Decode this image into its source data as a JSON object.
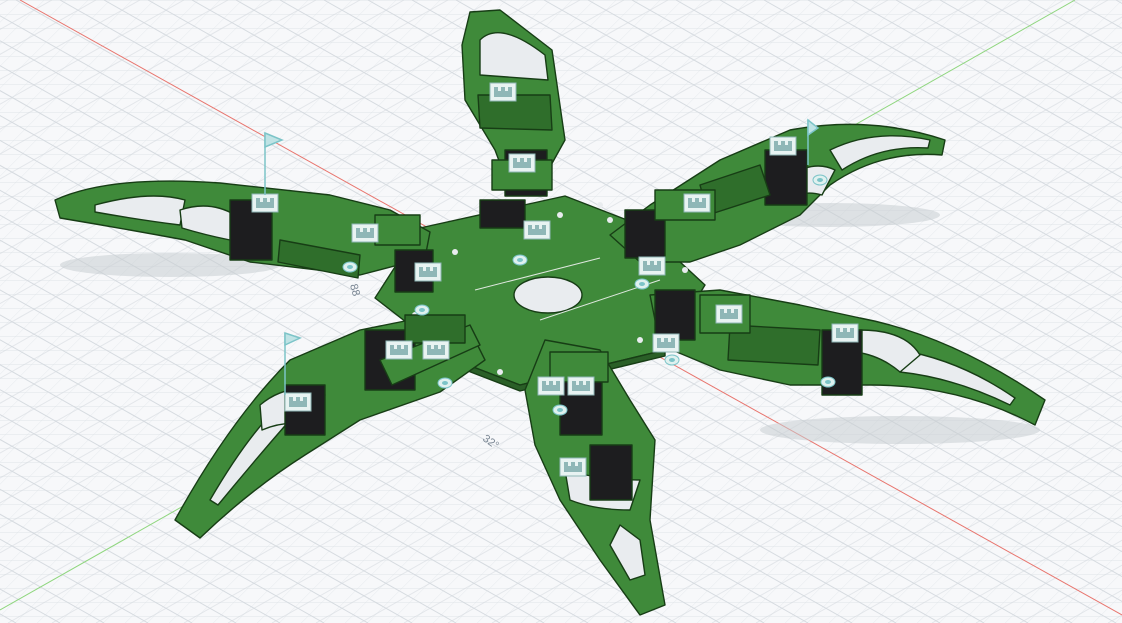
{
  "viewport": {
    "background": "#f7f8fa",
    "grid_color": "#dde1e6",
    "grid_major_color": "#cdd2d8",
    "axis_x_color": "#e8746d",
    "axis_y_color": "#8fd67e"
  },
  "model": {
    "body_color": "#3f8a3a",
    "body_edge_color": "#173d15",
    "servo_color": "#1d1d1f",
    "hole_color": "#e9ecef",
    "leg_count": 6,
    "joint_count": 18
  },
  "annotations": {
    "dimension_angle": "32°",
    "dimension_left": "88",
    "joint_icon": "rigid-joint-icon",
    "joint_origin_icon": "joint-origin-icon",
    "flag_icon": "flag-icon"
  }
}
